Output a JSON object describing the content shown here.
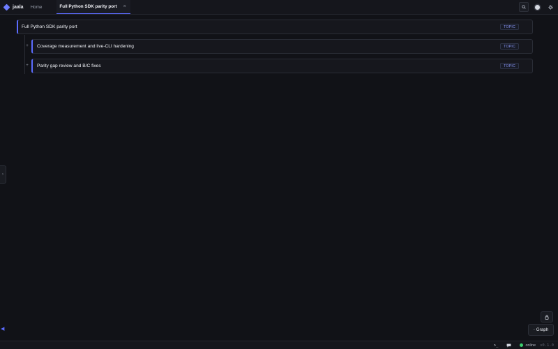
{
  "app": {
    "name": "jaala"
  },
  "tabs": [
    {
      "label": "Home"
    },
    {
      "label": "Full Python SDK parity port",
      "close": "×"
    }
  ],
  "tree": {
    "root": {
      "title": "Full Python SDK parity port",
      "badge": "TOPIC"
    },
    "children": [
      {
        "title": "Coverage measurement and live-CLI hardening",
        "badge": "TOPIC",
        "expander": "+"
      },
      {
        "title": "Parity gap review and B/C fixes",
        "badge": "TOPIC",
        "expander": "+"
      }
    ]
  },
  "side_handle": {
    "glyph": "›"
  },
  "collapse_arrow": {
    "glyph": "◀"
  },
  "graph_button": {
    "icon": "◦",
    "label": "Graph"
  },
  "status": {
    "terminal": ">_",
    "connection": "online",
    "version": "v0.1.0"
  },
  "colors": {
    "accent": "#5c6cff",
    "online": "#3ccf6e",
    "background": "#111217"
  },
  "icons": [
    "diamond-logo-icon",
    "close-icon",
    "search-icon",
    "record-icon",
    "gear-icon",
    "lock-icon",
    "graph-icon",
    "terminal-icon",
    "chat-icon"
  ]
}
